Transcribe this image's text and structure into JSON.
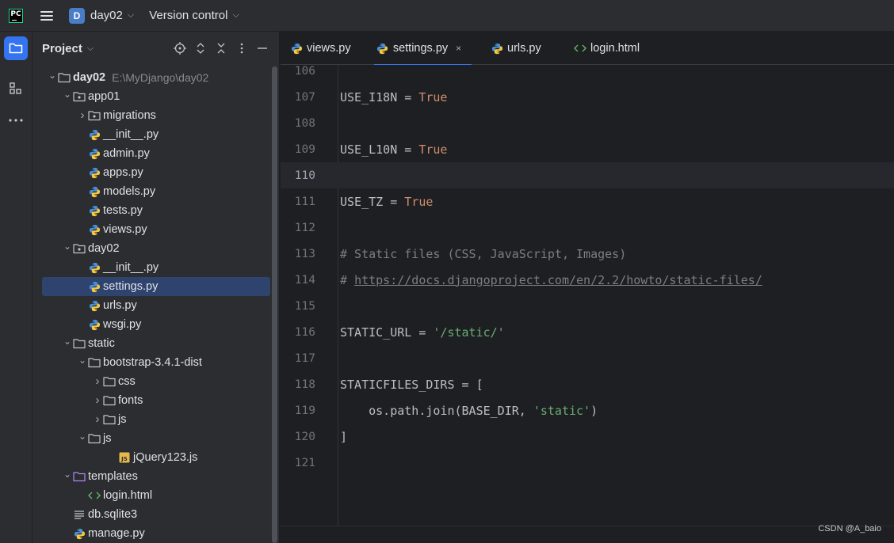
{
  "titlebar": {
    "app_logo_text": "PC",
    "project_badge": "D",
    "project_name": "day02",
    "vcs_label": "Version control"
  },
  "panel": {
    "title": "Project"
  },
  "tree": [
    {
      "label": "day02",
      "hint": "E:\\MyDjango\\day02",
      "type": "folder",
      "depth": 0,
      "expanded": true,
      "bold": true
    },
    {
      "label": "app01",
      "type": "package",
      "depth": 1,
      "expanded": true
    },
    {
      "label": "migrations",
      "type": "package",
      "depth": 2,
      "expanded": false
    },
    {
      "label": "__init__.py",
      "type": "python",
      "depth": 2
    },
    {
      "label": "admin.py",
      "type": "python",
      "depth": 2
    },
    {
      "label": "apps.py",
      "type": "python",
      "depth": 2
    },
    {
      "label": "models.py",
      "type": "python",
      "depth": 2
    },
    {
      "label": "tests.py",
      "type": "python",
      "depth": 2
    },
    {
      "label": "views.py",
      "type": "python",
      "depth": 2
    },
    {
      "label": "day02",
      "type": "package",
      "depth": 1,
      "expanded": true
    },
    {
      "label": "__init__.py",
      "type": "python",
      "depth": 2
    },
    {
      "label": "settings.py",
      "type": "python",
      "depth": 2,
      "selected": true
    },
    {
      "label": "urls.py",
      "type": "python",
      "depth": 2
    },
    {
      "label": "wsgi.py",
      "type": "python",
      "depth": 2
    },
    {
      "label": "static",
      "type": "folder",
      "depth": 1,
      "expanded": true
    },
    {
      "label": "bootstrap-3.4.1-dist",
      "type": "folder",
      "depth": 2,
      "expanded": true
    },
    {
      "label": "css",
      "type": "folder",
      "depth": 3,
      "expanded": false
    },
    {
      "label": "fonts",
      "type": "folder",
      "depth": 3,
      "expanded": false
    },
    {
      "label": "js",
      "type": "folder",
      "depth": 3,
      "expanded": false
    },
    {
      "label": "js",
      "type": "folder",
      "depth": 2,
      "expanded": true
    },
    {
      "label": "jQuery123.js",
      "type": "js",
      "depth": 4
    },
    {
      "label": "templates",
      "type": "templates",
      "depth": 1,
      "expanded": true
    },
    {
      "label": "login.html",
      "type": "html",
      "depth": 2
    },
    {
      "label": "db.sqlite3",
      "type": "text",
      "depth": 1
    },
    {
      "label": "manage.py",
      "type": "python",
      "depth": 1
    }
  ],
  "tabs": [
    {
      "label": "views.py",
      "type": "python",
      "active": false
    },
    {
      "label": "settings.py",
      "type": "python",
      "active": true,
      "close": "×"
    },
    {
      "label": "urls.py",
      "type": "python",
      "active": false
    },
    {
      "label": "login.html",
      "type": "html",
      "active": false
    }
  ],
  "code": [
    {
      "n": "106",
      "parts": []
    },
    {
      "n": "107",
      "parts": [
        {
          "t": "USE_I18N = "
        },
        {
          "t": "True",
          "c": "kw"
        }
      ]
    },
    {
      "n": "108",
      "parts": []
    },
    {
      "n": "109",
      "parts": [
        {
          "t": "USE_L10N = "
        },
        {
          "t": "True",
          "c": "kw"
        }
      ]
    },
    {
      "n": "110",
      "parts": [],
      "current": true
    },
    {
      "n": "111",
      "parts": [
        {
          "t": "USE_TZ = "
        },
        {
          "t": "True",
          "c": "kw"
        }
      ]
    },
    {
      "n": "112",
      "parts": []
    },
    {
      "n": "113",
      "parts": [
        {
          "t": "# Static files (CSS, JavaScript, Images)",
          "c": "cm"
        }
      ]
    },
    {
      "n": "114",
      "parts": [
        {
          "t": "# ",
          "c": "cm"
        },
        {
          "t": "https://docs.djangoproject.com/en/2.2/howto/static-files/",
          "c": "link"
        }
      ]
    },
    {
      "n": "115",
      "parts": []
    },
    {
      "n": "116",
      "parts": [
        {
          "t": "STATIC_URL = "
        },
        {
          "t": "'/static/'",
          "c": "str"
        }
      ]
    },
    {
      "n": "117",
      "parts": []
    },
    {
      "n": "118",
      "parts": [
        {
          "t": "STATICFILES_DIRS = ["
        }
      ]
    },
    {
      "n": "119",
      "parts": [
        {
          "t": "    os.path.join(BASE_DIR, "
        },
        {
          "t": "'static'",
          "c": "str"
        },
        {
          "t": ")"
        }
      ]
    },
    {
      "n": "120",
      "parts": [
        {
          "t": "]"
        }
      ]
    },
    {
      "n": "121",
      "parts": []
    }
  ],
  "watermark": "CSDN @A_baio",
  "colors": {
    "accent": "#3574f0",
    "keyword": "#cf8e6d",
    "string": "#6aab73",
    "comment": "#7a7e85"
  }
}
